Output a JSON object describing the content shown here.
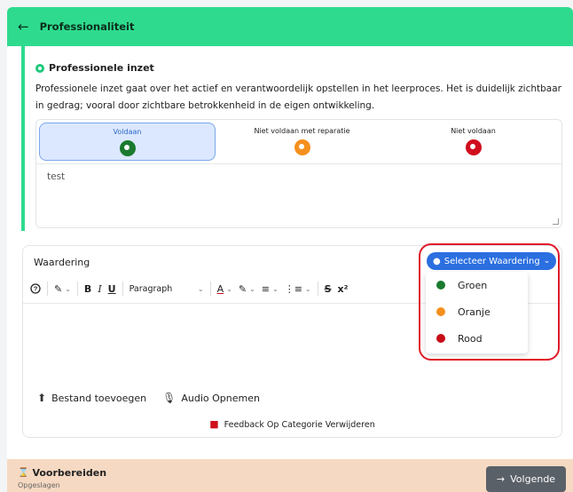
{
  "header": {
    "title": "Professionaliteit",
    "back_icon": "arrow-left-icon"
  },
  "criterion": {
    "title": "Professionele inzet",
    "description": "Professionele inzet gaat over het actief en verantwoordelijk opstellen in het leerproces. Het is duidelijk zichtbaar in gedrag; vooral door zichtbare betrokkenheid in de eigen ontwikkeling.",
    "options": [
      {
        "label": "Voldaan",
        "color": "#1a7a2e",
        "selected": true
      },
      {
        "label": "Niet voldaan met reparatie",
        "color": "#f5901e",
        "selected": false
      },
      {
        "label": "Niet voldaan",
        "color": "#d10e1d",
        "selected": false
      }
    ],
    "comment": "test"
  },
  "editor": {
    "title": "Waardering",
    "toolbar": {
      "bold": "B",
      "italic": "I",
      "underline": "U",
      "paragraph": "Paragraph",
      "strike": "S",
      "superscript": "x²"
    },
    "add_file": "Bestand toevoegen",
    "record_audio": "Audio Opnemen",
    "delete_feedback": "Feedback Op Categorie Verwijderen"
  },
  "dropdown": {
    "button_label": "Selecteer Waardering",
    "items": [
      {
        "label": "Groen",
        "color": "#1a7a2e"
      },
      {
        "label": "Oranje",
        "color": "#f5901e"
      },
      {
        "label": "Rood",
        "color": "#c60d18"
      }
    ]
  },
  "footer": {
    "stage": "Voorbereiden",
    "status": "Opgeslagen",
    "next_label": "Volgende"
  }
}
